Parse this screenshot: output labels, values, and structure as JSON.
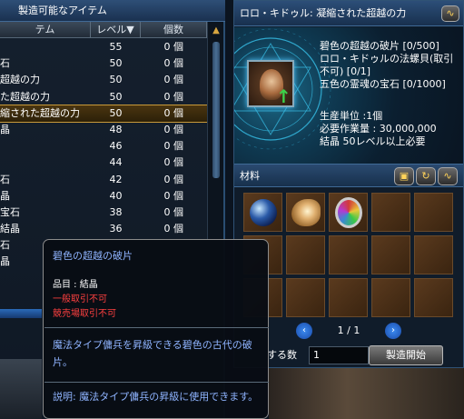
{
  "left_window": {
    "title": "製造可能なアイテム",
    "columns": {
      "item": "テム",
      "level": "レベル▼",
      "count": "個数"
    },
    "rows": [
      {
        "name": "",
        "level": "55",
        "count": "0 個"
      },
      {
        "name": "石",
        "level": "50",
        "count": "0 個"
      },
      {
        "name": "超越の力",
        "level": "50",
        "count": "0 個"
      },
      {
        "name": "た超越の力",
        "level": "50",
        "count": "0 個"
      },
      {
        "name": "縮された超越の力",
        "level": "50",
        "count": "0 個",
        "selected": true
      },
      {
        "name": "晶",
        "level": "48",
        "count": "0 個"
      },
      {
        "name": "",
        "level": "46",
        "count": "0 個"
      },
      {
        "name": "",
        "level": "44",
        "count": "0 個"
      },
      {
        "name": "石",
        "level": "42",
        "count": "0 個"
      },
      {
        "name": "晶",
        "level": "40",
        "count": "0 個"
      },
      {
        "name": "宝石",
        "level": "38",
        "count": "0 個"
      },
      {
        "name": "結晶",
        "level": "36",
        "count": "0 個"
      },
      {
        "name": "石",
        "level": "",
        "count": ""
      },
      {
        "name": "晶",
        "level": "",
        "count": ""
      }
    ],
    "scroll_up_icon": "chevron-up-icon"
  },
  "craft_window": {
    "title": "ロロ・キドゥル: 凝縮された超越の力",
    "graph_icon": "graph-icon",
    "materials_required": [
      "碧色の超越の破片 [0/500]",
      "ロロ・キドゥルの法螺貝(取引",
      "不可) [0/1]",
      "五色の霊魂の宝石 [0/1000]"
    ],
    "production": [
      "生産単位 :1個",
      "必要作業量 : 30,000,000",
      "結晶 50レベル以上必要"
    ],
    "materials_label": "材料",
    "material_slots": [
      "blue-shard-icon",
      "conch-shell-icon",
      "rainbow-gem-icon",
      "",
      "",
      "",
      "",
      "",
      "",
      "",
      "",
      "",
      "",
      "",
      ""
    ],
    "pager": {
      "prev": "‹",
      "next": "›",
      "page": "1 / 1"
    },
    "quantity_label": "する数",
    "quantity_value": "1",
    "craft_button": "製造開始"
  },
  "tooltip": {
    "title": "碧色の超越の破片",
    "type": "品目 : 結晶",
    "restriction1": "一般取引不可",
    "restriction2": "競売場取引不可",
    "description": "魔法タイプ傭兵を昇級できる碧色の古代の破片。",
    "usage": "説明: 魔法タイプ傭兵の昇級に使用できます。"
  },
  "colors": {
    "accent": "#8fb4ff",
    "warning": "#ff4040",
    "gold": "#c89a3a"
  }
}
